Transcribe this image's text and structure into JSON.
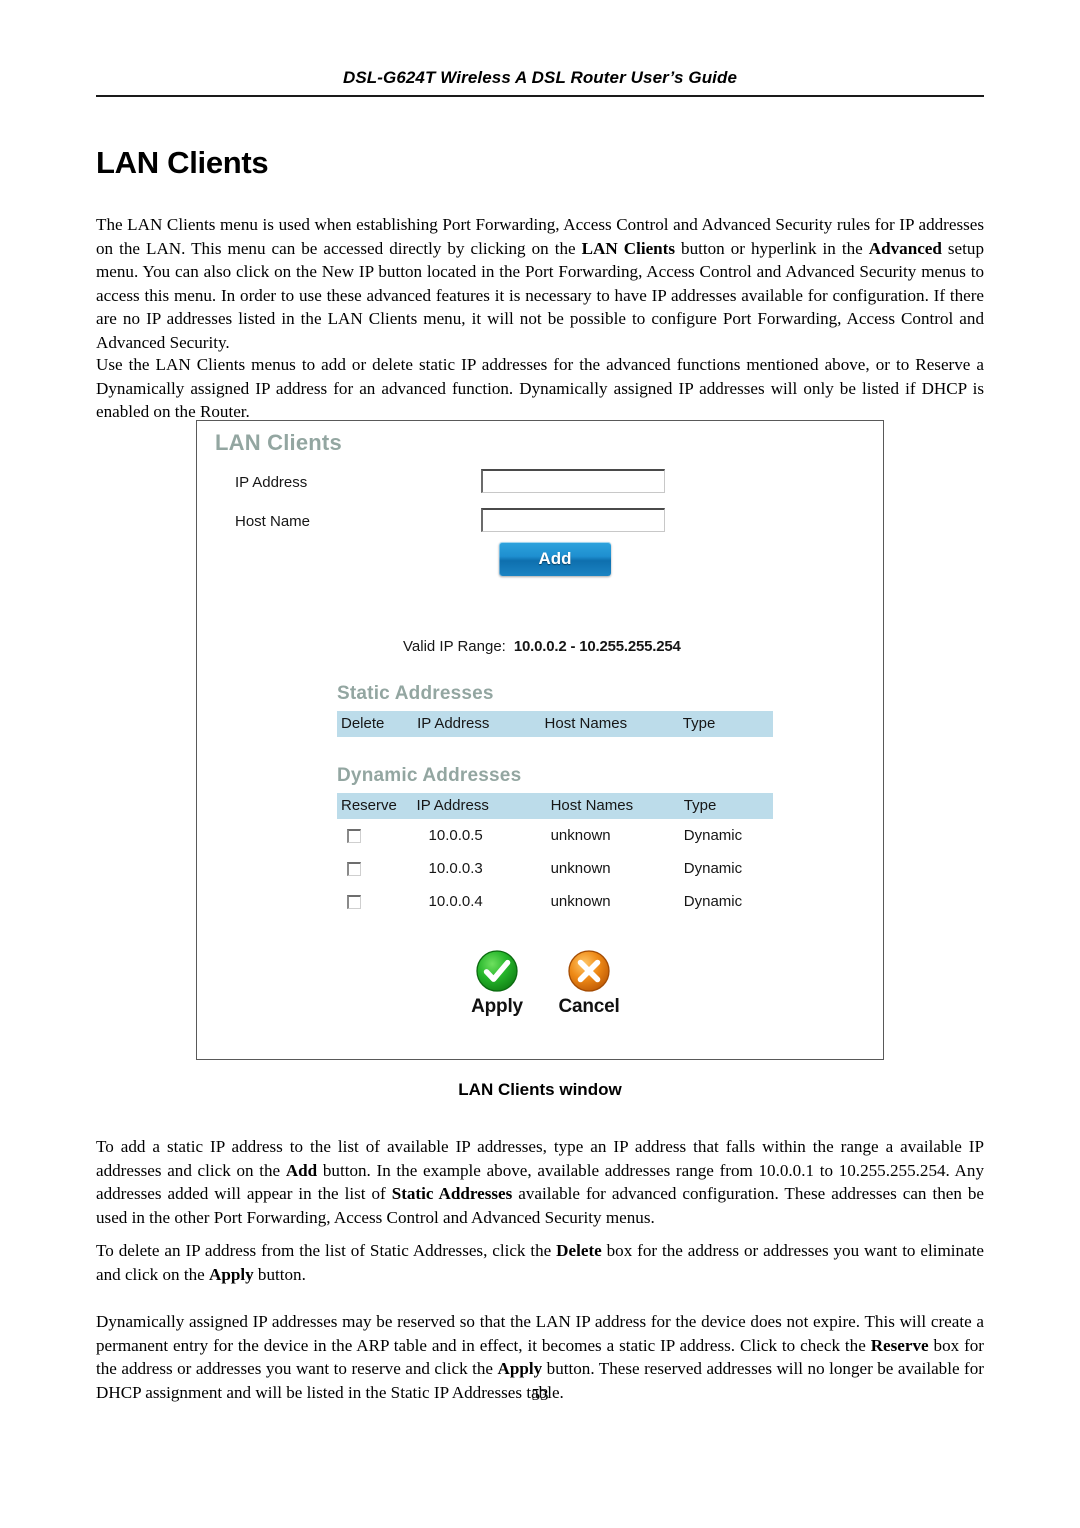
{
  "document": {
    "running_header": "DSL-G624T Wireless A DSL Router User’s Guide",
    "page_title": "LAN Clients",
    "page_number": "53",
    "figure_caption": "LAN Clients window"
  },
  "paragraphs": {
    "intro_1": "The LAN Clients menu is used when establishing Port Forwarding, Access Control and Advanced Security rules for IP addresses on the LAN. This menu can be accessed directly by clicking on the ",
    "intro_b1": "LAN Clients",
    "intro_2": " button or hyperlink in the ",
    "intro_b2": "Advanced",
    "intro_3": " setup menu. You can also click on the New IP button located in the Port Forwarding, Access Control and Advanced Security menus to access this menu. In order to use these advanced features it is necessary to have IP addresses available for configuration. If there are no IP addresses listed in the LAN Clients menu, it will not be possible to configure Port Forwarding, Access Control and Advanced Security.",
    "use": "Use the LAN Clients menus to add or delete static IP addresses for the advanced functions mentioned above, or to Reserve a Dynamically assigned IP address for an advanced function. Dynamically assigned IP addresses will only be listed if DHCP is enabled on the Router.",
    "add_1": "To add a static IP address to the list of available IP addresses, type an IP address that falls within the range a available IP addresses and click on the ",
    "add_b1": "Add",
    "add_2": " button. In the example above, available addresses range from 10.0.0.1 to 10.255.255.254. Any addresses added will appear in the list of ",
    "add_b2": "Static Addresses",
    "add_3": " available for advanced configuration. These addresses can then be used in the other Port Forwarding, Access Control and Advanced Security menus.",
    "delete_1": "To delete an IP address from the list of Static Addresses, click the ",
    "delete_b1": "Delete",
    "delete_2": " box for the address or addresses you want to eliminate and click on the ",
    "delete_b2": "Apply",
    "delete_3": " button.",
    "reserve_1": "Dynamically assigned IP addresses may be reserved so that the LAN IP address for the device does not expire. This will create a permanent entry for the device in the ARP table and in effect, it becomes a static IP address. Click to check the ",
    "reserve_b1": "Reserve",
    "reserve_2": " box for the address or addresses you want to reserve and click the ",
    "reserve_b2": "Apply",
    "reserve_3": " button. These reserved addresses will no longer be available for DHCP assignment and will be listed in the Static IP Addresses table."
  },
  "figure": {
    "title": "LAN Clients",
    "fields": {
      "ip_address_label": "IP Address",
      "ip_address_value": "",
      "ip_address_placeholder": "",
      "host_name_label": "Host Name",
      "host_name_value": "",
      "host_name_placeholder": ""
    },
    "add_button_label": "Add",
    "valid_range": {
      "label": "Valid IP Range:",
      "value": "10.0.0.2 -  10.255.255.254",
      "from": "10.0.0.2",
      "to": "10.255.255.254"
    },
    "static_addresses": {
      "heading": "Static Addresses",
      "columns": [
        "Delete",
        "IP Address",
        "Host Names",
        "Type"
      ],
      "rows": []
    },
    "dynamic_addresses": {
      "heading": "Dynamic Addresses",
      "columns": [
        "Reserve",
        "IP Address",
        "Host Names",
        "Type"
      ],
      "rows": [
        {
          "reserved": false,
          "ip": "10.0.0.5",
          "host": "unknown",
          "type": "Dynamic"
        },
        {
          "reserved": false,
          "ip": "10.0.0.3",
          "host": "unknown",
          "type": "Dynamic"
        },
        {
          "reserved": false,
          "ip": "10.0.0.4",
          "host": "unknown",
          "type": "Dynamic"
        }
      ]
    },
    "actions": [
      {
        "label": "Apply",
        "icon": "green-check-circle-icon",
        "color": "#17a319"
      },
      {
        "label": "Cancel",
        "icon": "orange-x-circle-icon",
        "color": "#e8821a"
      }
    ]
  },
  "colors": {
    "ui_heading": "#93a6a1",
    "table_header_bg": "#bcdcea",
    "add_button": "#1e8fd0",
    "apply_green": "#17a319",
    "cancel_orange": "#e8821a"
  }
}
